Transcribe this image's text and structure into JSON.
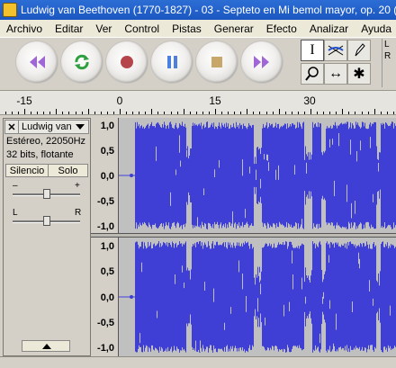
{
  "window": {
    "title": "Ludwig van Beethoven (1770-1827) - 03 - Septeto en Mi bemol mayor, op. 20 ("
  },
  "menu": [
    "Archivo",
    "Editar",
    "Ver",
    "Control",
    "Pistas",
    "Generar",
    "Efecto",
    "Analizar",
    "Ayuda"
  ],
  "transport": [
    {
      "name": "skip-start-button",
      "icon": "skip-to-start-icon"
    },
    {
      "name": "loop-play-button",
      "icon": "loop-icon"
    },
    {
      "name": "record-button",
      "icon": "record-icon"
    },
    {
      "name": "pause-button",
      "icon": "pause-icon"
    },
    {
      "name": "stop-button",
      "icon": "stop-icon"
    },
    {
      "name": "skip-end-button",
      "icon": "skip-to-end-icon"
    }
  ],
  "tools": {
    "selection": "I",
    "zoom": "⚲",
    "timeshift": "↔",
    "multi": "✱"
  },
  "meters": {
    "left": "L",
    "right": "R"
  },
  "ruler": {
    "ticks": [
      "-15",
      "0",
      "15",
      "30"
    ]
  },
  "track": {
    "name": "Ludwig van",
    "info_line1": "Estéreo, 22050Hz",
    "info_line2": "32 bits, flotante",
    "mute": "Silencio",
    "solo": "Solo",
    "gain_minus": "–",
    "gain_plus": "+",
    "pan_left": "L",
    "pan_right": "R",
    "gain": 0.5,
    "pan": 0.5
  },
  "amplitude_scale": [
    "1,0",
    "0,5",
    "0,0",
    "-0,5",
    "-1,0"
  ],
  "colors": {
    "waveform": "#3f3fd6",
    "waveform_bg": "#c0c0c0",
    "titlebar": "#1b56c0"
  }
}
